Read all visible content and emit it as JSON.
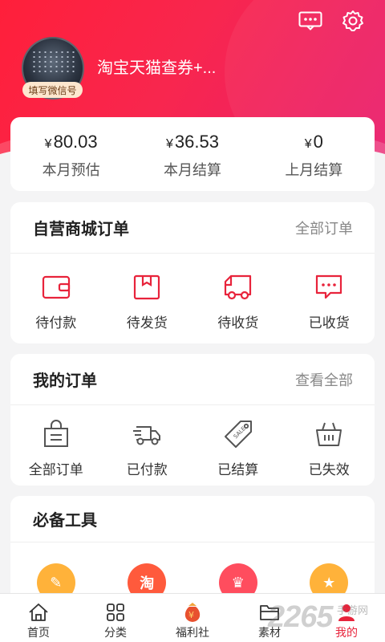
{
  "profile": {
    "username": "淘宝天猫查券+...",
    "wechat_badge": "填写微信号"
  },
  "stats": [
    {
      "value": "80.03",
      "currency": "¥",
      "label": "本月预估"
    },
    {
      "value": "36.53",
      "currency": "¥",
      "label": "本月结算"
    },
    {
      "value": "0",
      "currency": "¥",
      "label": "上月结算"
    }
  ],
  "shop_orders": {
    "title": "自营商城订单",
    "link": "全部订单",
    "items": [
      {
        "label": "待付款",
        "icon": "wallet-icon"
      },
      {
        "label": "待发货",
        "icon": "package-icon"
      },
      {
        "label": "待收货",
        "icon": "truck-icon"
      },
      {
        "label": "已收货",
        "icon": "message-icon"
      }
    ]
  },
  "my_orders": {
    "title": "我的订单",
    "link": "查看全部",
    "items": [
      {
        "label": "全部订单",
        "icon": "shopping-bag-icon"
      },
      {
        "label": "已付款",
        "icon": "delivery-truck-icon"
      },
      {
        "label": "已结算",
        "icon": "sale-tag-icon"
      },
      {
        "label": "已失效",
        "icon": "basket-icon"
      }
    ]
  },
  "tools": {
    "title": "必备工具",
    "items": [
      {
        "icon": "edit-icon",
        "glyph": "✎",
        "color": "#ffb23a"
      },
      {
        "icon": "taobao-icon",
        "glyph": "淘",
        "color": "#ff5a3c"
      },
      {
        "icon": "crown-icon",
        "glyph": "♛",
        "color": "#ff4d5e"
      },
      {
        "icon": "star-icon",
        "glyph": "★",
        "color": "#ffb23a"
      }
    ]
  },
  "tabbar": [
    {
      "label": "首页",
      "icon": "home-icon",
      "active": false
    },
    {
      "label": "分类",
      "icon": "category-icon",
      "active": false
    },
    {
      "label": "福利社",
      "icon": "money-bag-icon",
      "active": false
    },
    {
      "label": "素材",
      "icon": "folder-icon",
      "active": false
    },
    {
      "label": "我的",
      "icon": "user-icon",
      "active": true
    }
  ],
  "colors": {
    "header_start": "#ff1f3a",
    "header_end": "#e91f6e",
    "accent": "#e8233b"
  },
  "watermark": {
    "text": "2265",
    "sub": "手游网"
  }
}
